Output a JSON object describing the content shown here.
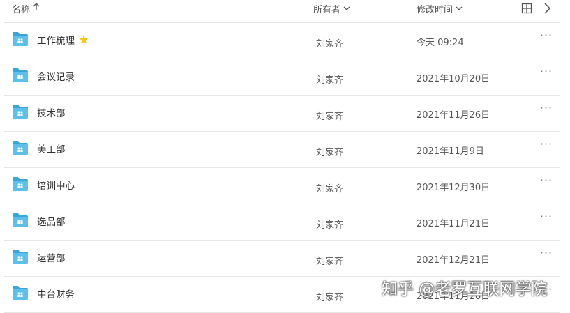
{
  "header": {
    "name_label": "名称",
    "owner_label": "所有者",
    "mtime_label": "修改时间",
    "name_sort_icon": "arrow-up-icon",
    "dropdown_icon": "chevron-down-icon",
    "grid_icon": "grid-view-icon",
    "next_icon": "chevron-right-icon"
  },
  "rows": [
    {
      "name": "工作梳理",
      "owner": "刘家齐",
      "mtime": "今天 09:24",
      "starred": true
    },
    {
      "name": "会议记录",
      "owner": "刘家齐",
      "mtime": "2021年10月20日",
      "starred": false
    },
    {
      "name": "技术部",
      "owner": "刘家齐",
      "mtime": "2021年11月26日",
      "starred": false
    },
    {
      "name": "美工部",
      "owner": "刘家齐",
      "mtime": "2021年11月9日",
      "starred": false
    },
    {
      "name": "培训中心",
      "owner": "刘家齐",
      "mtime": "2021年12月30日",
      "starred": false
    },
    {
      "name": "选品部",
      "owner": "刘家齐",
      "mtime": "2021年11月21日",
      "starred": false
    },
    {
      "name": "运营部",
      "owner": "刘家齐",
      "mtime": "2021年12月21日",
      "starred": false
    },
    {
      "name": "中台财务",
      "owner": "刘家齐",
      "mtime": "2021年11月26日",
      "starred": false
    }
  ],
  "more_label": "···",
  "watermark": "知乎 @老罗互联网学院",
  "colors": {
    "folder": "#5bc0eb",
    "folder_dark": "#3aa6d8",
    "star": "#f5c518",
    "divider": "#e6e6e6"
  }
}
